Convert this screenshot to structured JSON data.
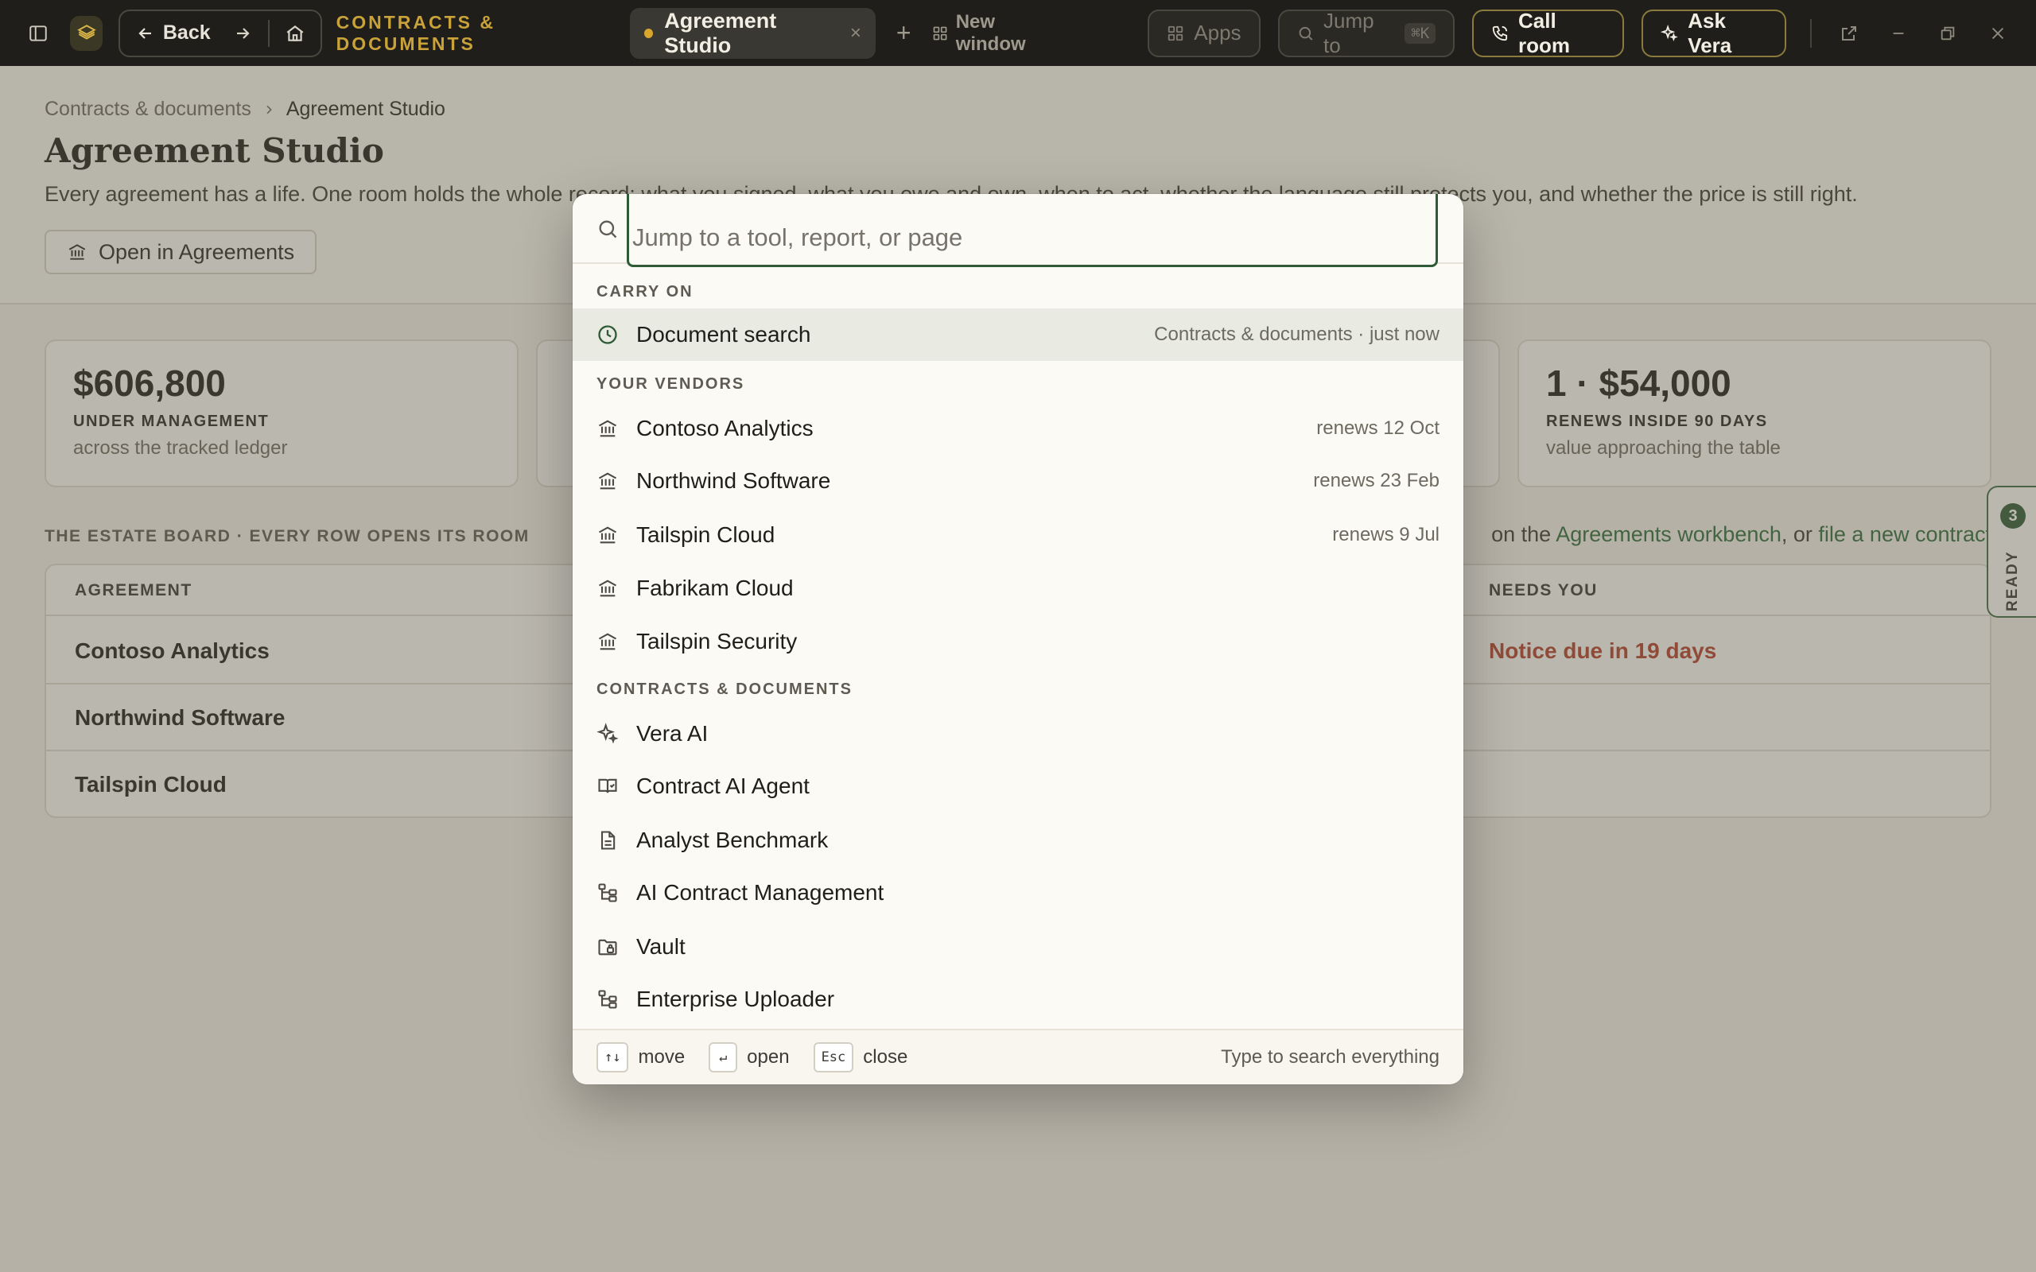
{
  "topbar": {
    "back_label": "Back",
    "section_title": "CONTRACTS & DOCUMENTS",
    "active_tab": "Agreement Studio",
    "tab_close": "×",
    "tab_add": "+",
    "new_window": "New window",
    "apps_label": "Apps",
    "jump_label": "Jump to",
    "jump_shortcut": "⌘K",
    "call_room": "Call room",
    "ask_vera": "Ask Vera",
    "accent": "#c9a33a"
  },
  "page": {
    "breadcrumb": [
      "Contracts & documents",
      "Agreement Studio"
    ],
    "title": "Agreement Studio",
    "description": "Every agreement has a life. One room holds the whole record: what you signed, what you owe and own, when to act, whether the language still protects you, and whether the price is still right.",
    "open_button": "Open in Agreements",
    "stats": [
      {
        "value": "$606,800",
        "label": "UNDER MANAGEMENT",
        "sub": "across the tracked ledger"
      },
      {
        "value": "1 · $54,000",
        "label": "RENEWS INSIDE 90 DAYS",
        "sub": "value approaching the table"
      }
    ],
    "board_title": "THE ESTATE BOARD · EVERY ROW OPENS ITS ROOM",
    "board_right_prefix": "on the ",
    "board_right_link1": "Agreements workbench",
    "board_right_mid": ", or ",
    "board_right_link2": "file a new contract",
    "columns": {
      "agreement": "AGREEMENT",
      "needs_you": "NEEDS YOU"
    },
    "rows": [
      {
        "name": "Contoso Analytics",
        "needs": "Notice due in 19 days"
      },
      {
        "name": "Northwind Software",
        "needs": ""
      },
      {
        "name": "Tailspin Cloud",
        "needs": ""
      }
    ],
    "ready": {
      "count": "3",
      "label": "READY"
    }
  },
  "palette": {
    "placeholder": "Jump to a tool, report, or page",
    "groups": {
      "carry_on": "CARRY ON",
      "vendors": "YOUR VENDORS",
      "contracts": "CONTRACTS & DOCUMENTS"
    },
    "recent": {
      "label": "Document search",
      "meta": "Contracts & documents · just now",
      "icon": "clock-icon"
    },
    "vendors": [
      {
        "label": "Contoso Analytics",
        "meta": "renews 12 Oct"
      },
      {
        "label": "Northwind Software",
        "meta": "renews 23 Feb"
      },
      {
        "label": "Tailspin Cloud",
        "meta": "renews 9 Jul"
      },
      {
        "label": "Fabrikam Cloud",
        "meta": ""
      },
      {
        "label": "Tailspin Security",
        "meta": ""
      }
    ],
    "tools": [
      {
        "label": "Vera AI",
        "icon": "sparkle-icon"
      },
      {
        "label": "Contract AI Agent",
        "icon": "book-check-icon"
      },
      {
        "label": "Analyst Benchmark",
        "icon": "document-icon"
      },
      {
        "label": "AI Contract Management",
        "icon": "tree-icon"
      },
      {
        "label": "Vault",
        "icon": "folder-lock-icon"
      },
      {
        "label": "Enterprise Uploader",
        "icon": "tree-icon"
      }
    ],
    "footer": {
      "move_key": "↑↓",
      "move": "move",
      "open_key": "↵",
      "open": "open",
      "close_key": "Esc",
      "close": "close",
      "hint": "Type to search everything"
    }
  }
}
